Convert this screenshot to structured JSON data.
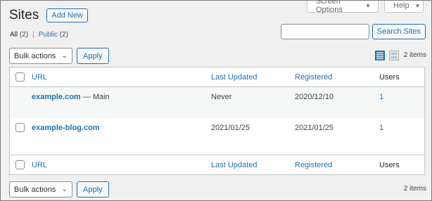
{
  "header": {
    "title": "Sites",
    "add_new": "Add New"
  },
  "screen_meta": {
    "screen_options": "Screen Options",
    "help": "Help"
  },
  "views": {
    "all_label": "All",
    "all_count": "(2)",
    "separator": "|",
    "public_label": "Public",
    "public_count": "(2)"
  },
  "search": {
    "placeholder": "",
    "button": "Search Sites"
  },
  "bulk": {
    "selected": "Bulk actions",
    "apply": "Apply"
  },
  "items_count": "2 items",
  "view_modes": [
    "list-view-icon",
    "excerpt-view-icon"
  ],
  "table": {
    "columns": [
      "URL",
      "Last Updated",
      "Registered",
      "Users"
    ],
    "rows": [
      {
        "url": "example.com",
        "suffix": " — Main",
        "last_updated": "Never",
        "registered": "2020/12/10",
        "users": "1"
      },
      {
        "url": "example-blog.com",
        "suffix": "",
        "last_updated": "2021/01/25",
        "registered": "2021/01/25",
        "users": "1"
      }
    ]
  },
  "colors": {
    "accent": "#2271b1",
    "background": "#f0f0f1",
    "alt_row": "#f6f7f7"
  }
}
